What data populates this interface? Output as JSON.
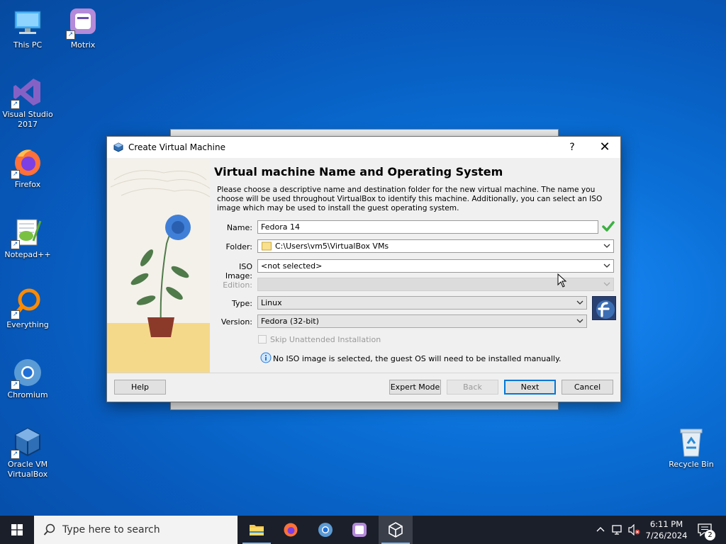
{
  "desktop": {
    "icons": [
      {
        "label": "This PC"
      },
      {
        "label": "Motrix"
      },
      {
        "label": "Visual Studio 2017"
      },
      {
        "label": "Firefox"
      },
      {
        "label": "Notepad++"
      },
      {
        "label": "Everything"
      },
      {
        "label": "Chromium"
      },
      {
        "label": "Oracle VM VirtualBox"
      },
      {
        "label": "Recycle Bin"
      }
    ]
  },
  "dialog": {
    "title": "Create Virtual Machine",
    "help_glyph": "?",
    "close_glyph": "✕",
    "heading": "Virtual machine Name and Operating System",
    "description": "Please choose a descriptive name and destination folder for the new virtual machine. The name you choose will be used throughout VirtualBox to identify this machine. Additionally, you can select an ISO image which may be used to install the guest operating system.",
    "fields": {
      "name": {
        "label": "Name:",
        "value": "Fedora 14"
      },
      "folder": {
        "label": "Folder:",
        "value": "C:\\Users\\vm5\\VirtualBox VMs"
      },
      "iso": {
        "label": "ISO Image:",
        "value": "<not selected>"
      },
      "edition": {
        "label": "Edition:",
        "value": ""
      },
      "type": {
        "label": "Type:",
        "value": "Linux"
      },
      "version": {
        "label": "Version:",
        "value": "Fedora (32-bit)"
      }
    },
    "skip_unattended": {
      "label": "Skip Unattended Installation",
      "checked": false
    },
    "info_message": "No ISO image is selected, the guest OS will need to be installed manually.",
    "buttons": {
      "help": "Help",
      "expert_mode": "Expert Mode",
      "back": "Back",
      "next": "Next",
      "cancel": "Cancel"
    }
  },
  "taskbar": {
    "search_placeholder": "Type here to search",
    "apps": [
      "file-explorer",
      "firefox",
      "chromium",
      "motrix",
      "virtualbox"
    ],
    "active_app": "virtualbox",
    "clock": {
      "time": "6:11 PM",
      "date": "7/26/2024"
    },
    "notification_count": "2"
  },
  "colors": {
    "accent": "#0078d7",
    "check_green": "#3cb043",
    "taskbar": "#1b1f2a"
  }
}
